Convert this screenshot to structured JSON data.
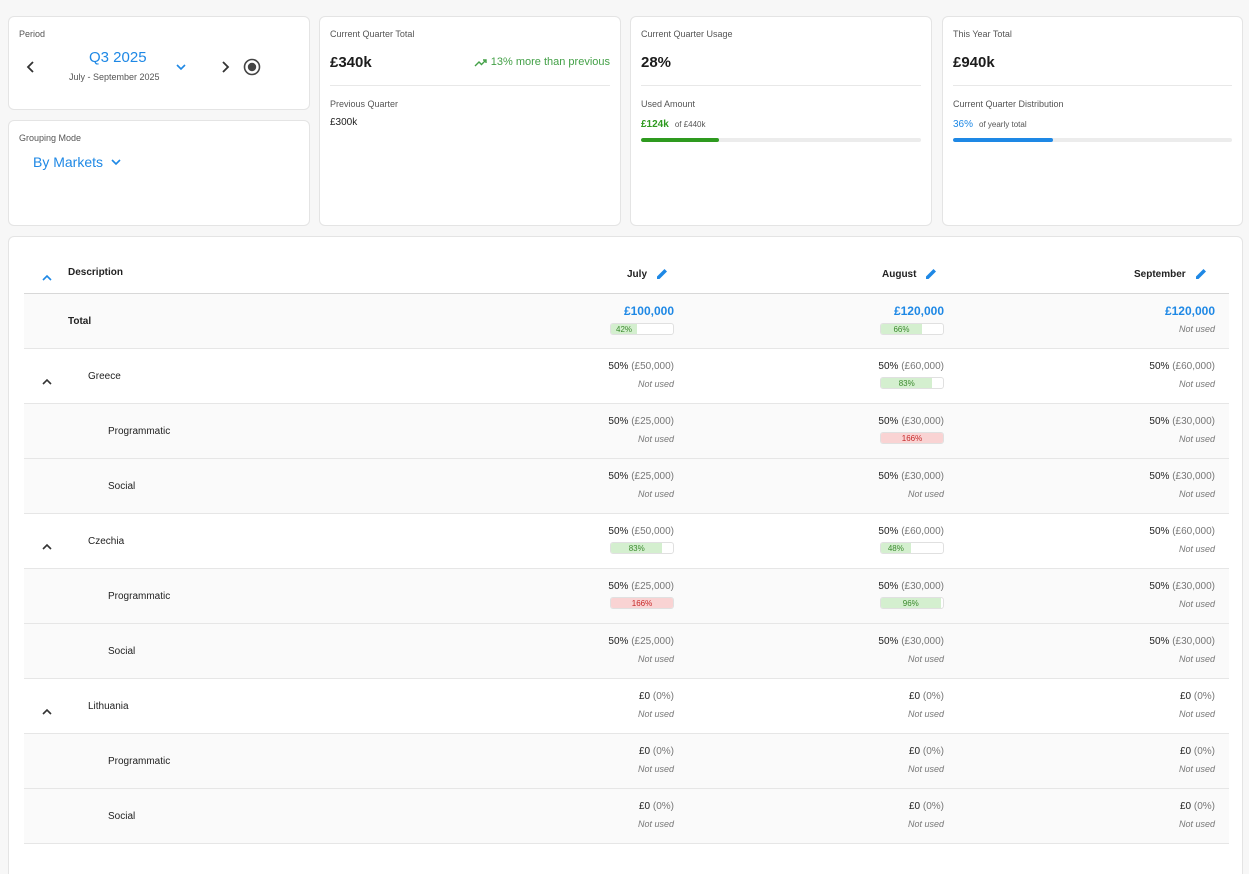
{
  "period": {
    "label": "Period",
    "quarter": "Q3 2025",
    "range": "July - September 2025"
  },
  "grouping": {
    "label": "Grouping Mode",
    "value": "By Markets"
  },
  "quarter_total": {
    "label": "Current Quarter Total",
    "value": "£340k",
    "trend": "13% more than previous",
    "prev_label": "Previous Quarter",
    "prev_value": "£300k"
  },
  "quarter_usage": {
    "label": "Current Quarter Usage",
    "value": "28%",
    "used_label": "Used Amount",
    "used_value": "£124k",
    "used_of": "of £440k",
    "progress": 0.28,
    "color": "#2e9a1f"
  },
  "year_total": {
    "label": "This Year Total",
    "value": "£940k",
    "dist_label": "Current Quarter Distribution",
    "dist_value": "36%",
    "dist_of": "of yearly total",
    "progress": 0.36,
    "color": "#1e88e5"
  },
  "table": {
    "header": {
      "description": "Description",
      "months": [
        "July",
        "August",
        "September"
      ]
    },
    "rows": [
      {
        "label": "Total",
        "level": 0,
        "total": true,
        "cells": [
          {
            "amount": "£100,000",
            "badge": "42%",
            "pct": 0.42,
            "status": "ok"
          },
          {
            "amount": "£120,000",
            "badge": "66%",
            "pct": 0.66,
            "status": "ok"
          },
          {
            "amount": "£120,000",
            "note": "Not used"
          }
        ]
      },
      {
        "label": "Greece",
        "level": 1,
        "expandable": true,
        "cells": [
          {
            "amount": "50%",
            "paren": "(£50,000)",
            "note": "Not used"
          },
          {
            "amount": "50%",
            "paren": "(£60,000)",
            "badge": "83%",
            "pct": 0.83,
            "status": "ok"
          },
          {
            "amount": "50%",
            "paren": "(£60,000)",
            "note": "Not used"
          }
        ]
      },
      {
        "label": "Programmatic",
        "level": 2,
        "cells": [
          {
            "amount": "50%",
            "paren": "(£25,000)",
            "note": "Not used"
          },
          {
            "amount": "50%",
            "paren": "(£30,000)",
            "badge": "166%",
            "pct": 1.0,
            "status": "over"
          },
          {
            "amount": "50%",
            "paren": "(£30,000)",
            "note": "Not used"
          }
        ]
      },
      {
        "label": "Social",
        "level": 2,
        "cells": [
          {
            "amount": "50%",
            "paren": "(£25,000)",
            "note": "Not used"
          },
          {
            "amount": "50%",
            "paren": "(£30,000)",
            "note": "Not used"
          },
          {
            "amount": "50%",
            "paren": "(£30,000)",
            "note": "Not used"
          }
        ]
      },
      {
        "label": "Czechia",
        "level": 1,
        "expandable": true,
        "cells": [
          {
            "amount": "50%",
            "paren": "(£50,000)",
            "badge": "83%",
            "pct": 0.83,
            "status": "ok"
          },
          {
            "amount": "50%",
            "paren": "(£60,000)",
            "badge": "48%",
            "pct": 0.48,
            "status": "ok"
          },
          {
            "amount": "50%",
            "paren": "(£60,000)",
            "note": "Not used"
          }
        ]
      },
      {
        "label": "Programmatic",
        "level": 2,
        "cells": [
          {
            "amount": "50%",
            "paren": "(£25,000)",
            "badge": "166%",
            "pct": 1.0,
            "status": "over"
          },
          {
            "amount": "50%",
            "paren": "(£30,000)",
            "badge": "96%",
            "pct": 0.96,
            "status": "ok"
          },
          {
            "amount": "50%",
            "paren": "(£30,000)",
            "note": "Not used"
          }
        ]
      },
      {
        "label": "Social",
        "level": 2,
        "cells": [
          {
            "amount": "50%",
            "paren": "(£25,000)",
            "note": "Not used"
          },
          {
            "amount": "50%",
            "paren": "(£30,000)",
            "note": "Not used"
          },
          {
            "amount": "50%",
            "paren": "(£30,000)",
            "note": "Not used"
          }
        ]
      },
      {
        "label": "Lithuania",
        "level": 1,
        "expandable": true,
        "cells": [
          {
            "amount": "£0",
            "paren": "(0%)",
            "note": "Not used"
          },
          {
            "amount": "£0",
            "paren": "(0%)",
            "note": "Not used"
          },
          {
            "amount": "£0",
            "paren": "(0%)",
            "note": "Not used"
          }
        ]
      },
      {
        "label": "Programmatic",
        "level": 2,
        "cells": [
          {
            "amount": "£0",
            "paren": "(0%)",
            "note": "Not used"
          },
          {
            "amount": "£0",
            "paren": "(0%)",
            "note": "Not used"
          },
          {
            "amount": "£0",
            "paren": "(0%)",
            "note": "Not used"
          }
        ]
      },
      {
        "label": "Social",
        "level": 2,
        "cells": [
          {
            "amount": "£0",
            "paren": "(0%)",
            "note": "Not used"
          },
          {
            "amount": "£0",
            "paren": "(0%)",
            "note": "Not used"
          },
          {
            "amount": "£0",
            "paren": "(0%)",
            "note": "Not used"
          }
        ]
      }
    ]
  },
  "colors": {
    "accent": "#1e88e5",
    "success": "#43a047",
    "badge_ok_fill": "#d4efcf",
    "badge_ok_text": "#3a8a2c",
    "badge_over_fill": "#f9d3d3",
    "badge_over_text": "#c62828"
  }
}
